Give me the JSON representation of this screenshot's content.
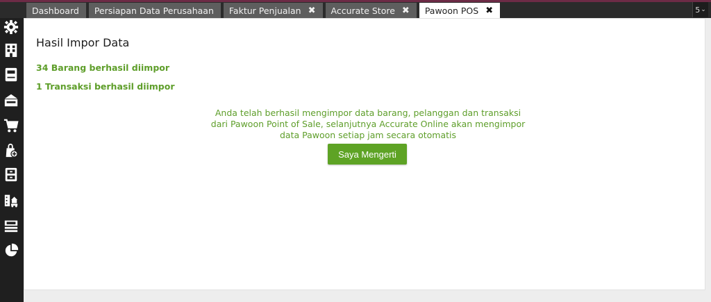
{
  "tabs": [
    {
      "label": "Dashboard",
      "closable": false,
      "active": false
    },
    {
      "label": "Persiapan Data Perusahaan",
      "closable": false,
      "active": false
    },
    {
      "label": "Faktur Penjualan",
      "closable": true,
      "active": false
    },
    {
      "label": "Accurate Store",
      "closable": true,
      "active": false
    },
    {
      "label": "Pawoon POS",
      "closable": true,
      "active": true
    }
  ],
  "tab_close_glyph": "✖",
  "tab_count": "5",
  "tab_count_chevron": "⌄",
  "sidebar": {
    "icons": [
      "settings-gear-icon",
      "company-building-icon",
      "ledger-book-icon",
      "purchase-card-icon",
      "cart-icon",
      "inventory-bag-icon",
      "cabinet-icon",
      "assets-buildings-icon",
      "cash-money-icon",
      "report-pie-chart-icon"
    ]
  },
  "main": {
    "title": "Hasil Impor Data",
    "results": [
      "34 Barang berhasil diimpor",
      "1 Transaksi berhasil diimpor"
    ],
    "message": "Anda telah berhasil mengimpor data barang, pelanggan dan transaksi dari Pawoon Point of Sale, selanjutnya Accurate Online akan mengimpor data Pawoon setiap jam secara otomatis",
    "confirm_button": "Saya Mengerti"
  },
  "colors": {
    "topbar": "#2b2b2b",
    "accent": "#6d2b46",
    "sidebar": "#1f1f1f",
    "success_text": "#5e9e2a",
    "button": "#5ea325"
  }
}
